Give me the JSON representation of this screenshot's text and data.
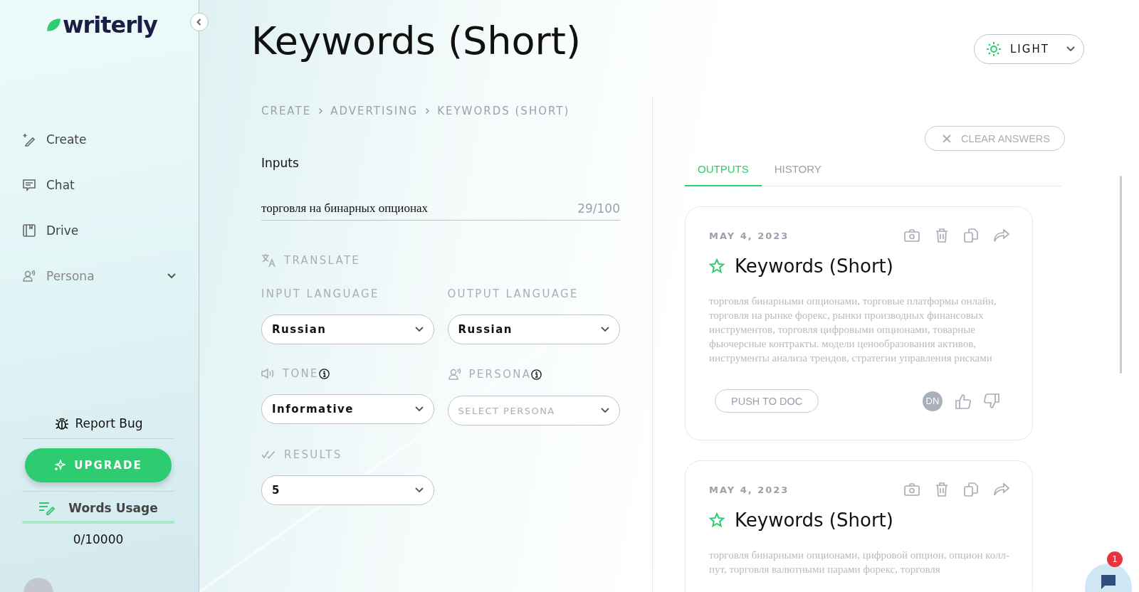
{
  "sidebar": {
    "logo": "writerly",
    "items": [
      {
        "label": "Create",
        "muted": false
      },
      {
        "label": "Chat",
        "muted": false
      },
      {
        "label": "Drive",
        "muted": false
      },
      {
        "label": "Persona",
        "muted": true
      }
    ],
    "report_bug": "Report Bug",
    "upgrade": "UPGRADE",
    "words_usage": {
      "label": "Words Usage",
      "level": 1,
      "count": "0/10000"
    }
  },
  "header": {
    "title": "Keywords (Short)",
    "theme": "LIGHT"
  },
  "breadcrumb": [
    "CREATE",
    "ADVERTISING",
    "KEYWORDS (SHORT)"
  ],
  "inputs": {
    "heading": "Inputs",
    "value": "торговля на бинарных опционах",
    "counter": "29/100",
    "translate": "TRANSLATE",
    "input_language": {
      "label": "INPUT LANGUAGE",
      "value": "Russian"
    },
    "output_language": {
      "label": "OUTPUT LANGUAGE",
      "value": "Russian"
    },
    "tone": {
      "label": "TONE",
      "value": "Informative"
    },
    "persona": {
      "label": "PERSONA",
      "placeholder": "SELECT PERSONA"
    },
    "results": {
      "label": "RESULTS",
      "value": "5"
    }
  },
  "clear_answers": "CLEAR ANSWERS",
  "tabs": [
    {
      "label": "OUTPUTS",
      "selected": true
    },
    {
      "label": "HISTORY",
      "selected": false
    }
  ],
  "outputs": [
    {
      "date": "MAY 4, 2023",
      "title": "Keywords (Short)",
      "text": "торговля бинарными опционами, торговые платформы онлайн, торговля на рынке форекс, рынки производных финансовых инструментов, торговля цифровыми опционами, товарные фьючерсные контракты. модели ценообразования активов, инструменты анализа трендов, стратегии управления рисками",
      "push": "PUSH TO DOC",
      "avatar": "DN"
    },
    {
      "date": "MAY 4, 2023",
      "title": "Keywords (Short)",
      "text": "торговля бинарными опционами, цифровой опцион, опцион колл-пут, торговля валютными парами форекс, торговля"
    }
  ],
  "chat_badge": "1"
}
